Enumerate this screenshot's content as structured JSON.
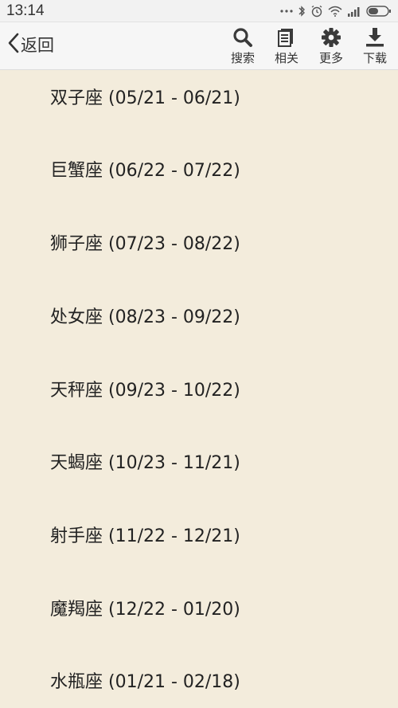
{
  "status_bar": {
    "time": "13:14",
    "icons": [
      "more-dots-icon",
      "bluetooth-icon",
      "alarm-icon",
      "wifi-icon",
      "signal-icon",
      "battery-icon"
    ]
  },
  "toolbar": {
    "back_label": "返回",
    "search_label": "搜索",
    "related_label": "相关",
    "more_label": "更多",
    "download_label": "下载"
  },
  "list": {
    "items": [
      {
        "label": "双子座 (05/21 - 06/21)"
      },
      {
        "label": "巨蟹座 (06/22 - 07/22)"
      },
      {
        "label": "狮子座 (07/23 - 08/22)"
      },
      {
        "label": "处女座 (08/23 - 09/22)"
      },
      {
        "label": "天秤座 (09/23 - 10/22)"
      },
      {
        "label": "天蝎座 (10/23 - 11/21)"
      },
      {
        "label": "射手座 (11/22 - 12/21)"
      },
      {
        "label": "魔羯座 (12/22 - 01/20)"
      },
      {
        "label": "水瓶座 (01/21 - 02/18)"
      }
    ]
  },
  "colors": {
    "background": "#f3ecdc",
    "toolbar": "#f6f6f6",
    "icon": "#3a3a3a"
  }
}
